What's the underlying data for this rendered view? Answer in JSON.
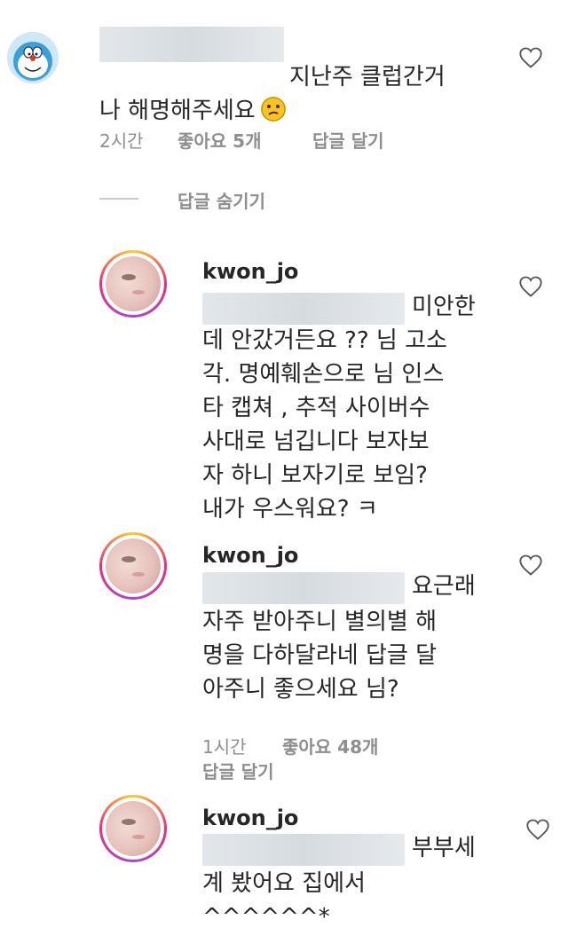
{
  "comment1": {
    "text": "지난주 클럽간거\n나 해명해주세요",
    "emoji": "confused-face-emoji",
    "time": "2시간",
    "likes": "좋아요 5개",
    "reply": "답글 달기",
    "hide_replies": "답글 숨기기"
  },
  "reply1": {
    "username": "kwon_jo",
    "text_line1": "미안한",
    "text_rest": "데 안갔거든요 ?? 님 고소\n각. 명예훼손으로 님 인스\n타 캡쳐 , 추적 사이버수\n사대로 넘깁니다 보자보\n자 하니 보자기로 보임?\n내가 우스워요? ㅋ"
  },
  "reply2": {
    "username": "kwon_jo",
    "text_line1": "요근래",
    "text_rest": "자주 받아주니 별의별 해\n명을 다하달라네 답글 달\n아주니 좋으세요 님?",
    "time": "1시간",
    "likes": "좋아요 48개",
    "reply": "답글 달기"
  },
  "reply3": {
    "username": "kwon_jo",
    "text_line1": "부부세",
    "text_rest": "계 봤어요 집에서\n^^^^^^*"
  },
  "colors": {
    "text": "#262626",
    "meta": "#8e8e8e"
  }
}
